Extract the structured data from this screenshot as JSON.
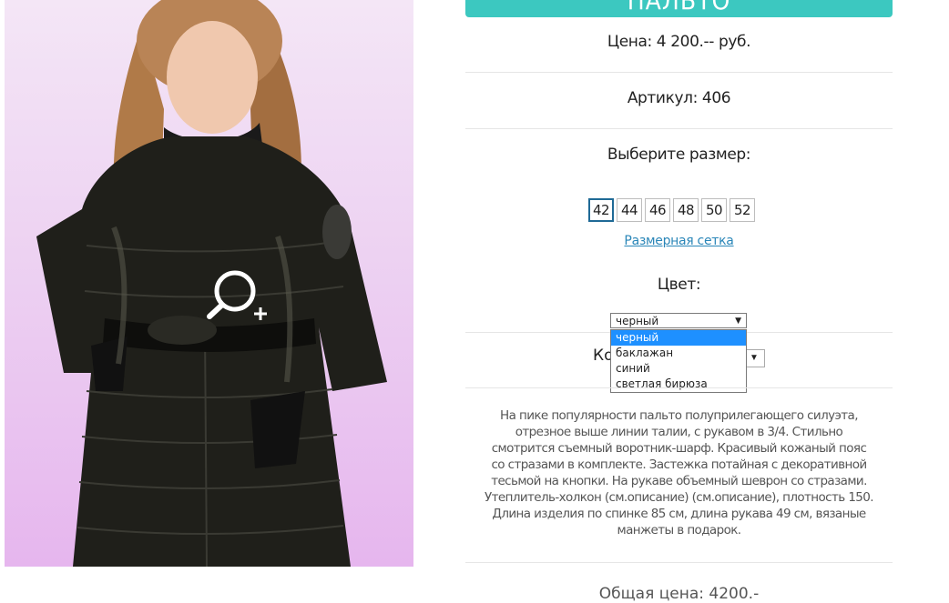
{
  "title": "ПАЛЬТО",
  "price": "Цена: 4 200.-- руб.",
  "sku": "Артикул: 406",
  "size_label": "Выберите размер:",
  "sizes": [
    "42",
    "44",
    "46",
    "48",
    "50",
    "52"
  ],
  "selected_size": "42",
  "size_chart_link": "Размерная сетка",
  "color_label": "Цвет:",
  "color_selected": "черный",
  "color_options": [
    "черный",
    "баклажан",
    "синий",
    "светлая бирюза"
  ],
  "quantity_label": "Ко",
  "description": "На пике популярности пальто полуприлегающего силуэта, отрезное выше линии талии, с рукавом в 3/4. Стильно смотрится съемный воротник-шарф. Красивый кожаный пояс со стразами в комплекте. Застежка потайная с декоративной тесьмой на кнопки. На рукаве объемный шеврон со стразами. Утеплитель-холкон (см.описание) (см.описание), плотность 150. Длина изделия по спинке 85 см, длина рукава 49 см, вязаные манжеты в подарок.",
  "total": "Общая цена: 4200.-",
  "colors": {
    "accent": "#3cc8c0",
    "link": "#2a86b8",
    "option_highlight": "#1e90ff"
  },
  "icons": {
    "zoom": "zoom-in-icon",
    "dropdown": "dropdown-arrow-icon"
  }
}
